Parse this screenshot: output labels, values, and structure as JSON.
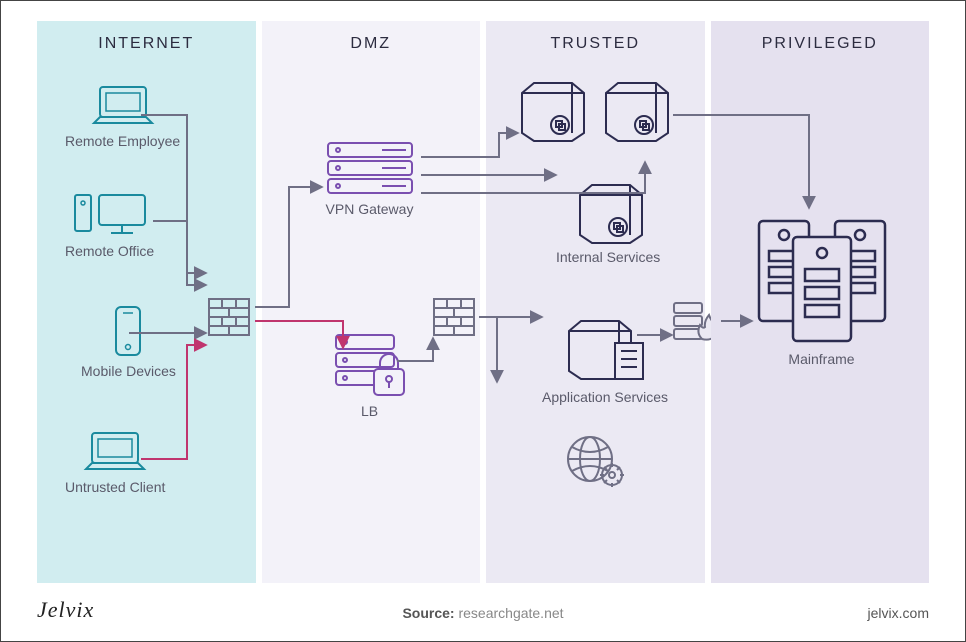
{
  "zones": {
    "internet": {
      "title": "INTERNET"
    },
    "dmz": {
      "title": "DMZ"
    },
    "trusted": {
      "title": "TRUSTED"
    },
    "privileged": {
      "title": "PRIVILEGED"
    }
  },
  "nodes": {
    "remote_employee": {
      "label": "Remote Employee"
    },
    "remote_office": {
      "label": "Remote Office"
    },
    "mobile_devices": {
      "label": "Mobile Devices"
    },
    "untrusted_client": {
      "label": "Untrusted Client"
    },
    "firewall_1": {
      "label": ""
    },
    "vpn_gateway": {
      "label": "VPN Gateway"
    },
    "lb": {
      "label": "LB"
    },
    "firewall_2": {
      "label": ""
    },
    "internal_services": {
      "label": "Internal Services"
    },
    "application_services": {
      "label": "Application Services"
    },
    "globe_gear": {
      "label": ""
    },
    "waf": {
      "label": ""
    },
    "mainframe": {
      "label": "Mainframe"
    }
  },
  "footer": {
    "brand": "Jelvix",
    "source_label": "Source:",
    "source_value": "researchgate.net",
    "site": "jelvix.com"
  },
  "colors": {
    "teal": "#1a8a9e",
    "purple": "#7a4fb0",
    "darknavy": "#2c2c50",
    "gray": "#6f6f85",
    "pink": "#c0356e"
  }
}
